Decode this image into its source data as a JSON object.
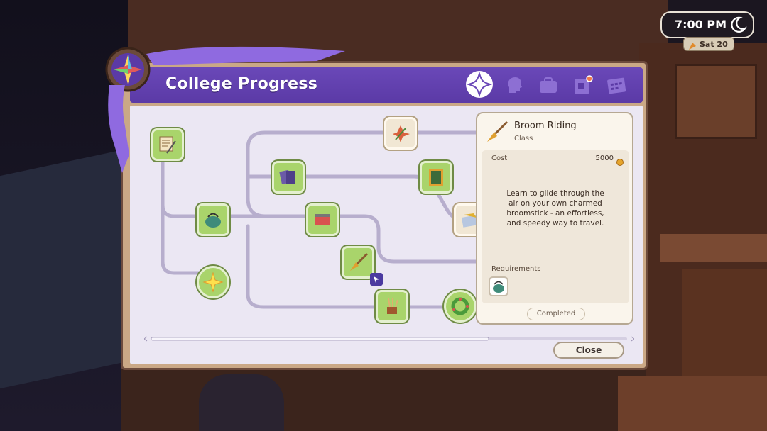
{
  "hud": {
    "time": "7:00 PM",
    "date": "Sat 20"
  },
  "panel": {
    "title": "College Progress",
    "tabs": [
      {
        "name": "tab-college",
        "icon": "sparkle-emblem-icon",
        "active": true
      },
      {
        "name": "tab-character",
        "icon": "head-profile-icon",
        "active": false
      },
      {
        "name": "tab-inventory",
        "icon": "briefcase-icon",
        "active": false
      },
      {
        "name": "tab-quests",
        "icon": "notice-board-icon",
        "active": false,
        "badge": true
      },
      {
        "name": "tab-calendar",
        "icon": "calendar-icon",
        "active": false
      }
    ],
    "close_label": "Close"
  },
  "tree_nodes": [
    {
      "name": "node-scroll-quill",
      "icon": "scroll-quill-icon",
      "state": "completed"
    },
    {
      "name": "node-kettle",
      "icon": "kettle-icon",
      "state": "completed"
    },
    {
      "name": "node-sun-spark",
      "icon": "sun-spark-icon",
      "state": "completed"
    },
    {
      "name": "node-cards",
      "icon": "tarot-cards-icon",
      "state": "completed"
    },
    {
      "name": "node-red-tin",
      "icon": "red-tin-icon",
      "state": "completed"
    },
    {
      "name": "node-broom",
      "icon": "broom-icon",
      "state": "completed"
    },
    {
      "name": "node-potion-brush",
      "icon": "brush-pot-icon",
      "state": "completed"
    },
    {
      "name": "node-herb",
      "icon": "red-herb-icon",
      "state": "locked"
    },
    {
      "name": "node-painting",
      "icon": "framed-picture-icon",
      "state": "completed"
    },
    {
      "name": "node-wreath",
      "icon": "wreath-icon",
      "state": "completed"
    },
    {
      "name": "node-blueprint",
      "icon": "blueprint-icon",
      "state": "locked"
    }
  ],
  "info_card": {
    "title": "Broom Riding",
    "subtitle": "Class",
    "cost_label": "Cost",
    "cost_value": "5000",
    "description": "Learn to glide through the air on your own charmed broomstick - an effortless, and speedy way to travel.",
    "requirements_label": "Requirements",
    "status": "Completed"
  },
  "colors": {
    "header_purple": "#5b3aa6",
    "node_green": "#a9d46b",
    "panel_bg": "#ebe7f3",
    "frame_brown": "#6d4b3d"
  }
}
